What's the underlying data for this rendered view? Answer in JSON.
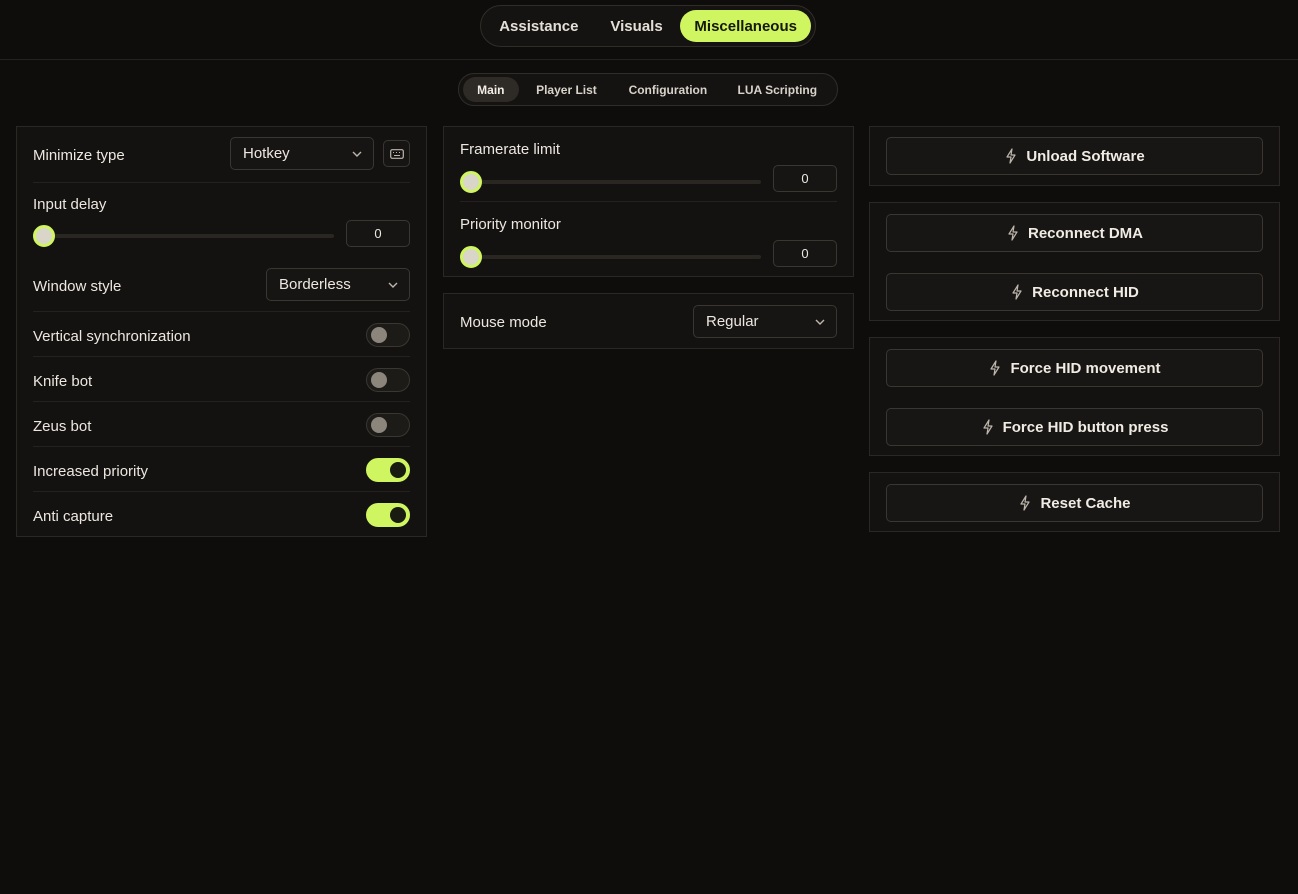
{
  "main_tabs": [
    {
      "label": "Assistance",
      "active": false
    },
    {
      "label": "Visuals",
      "active": false
    },
    {
      "label": "Miscellaneous",
      "active": true
    }
  ],
  "sub_tabs": [
    {
      "label": "Main",
      "active": true
    },
    {
      "label": "Player List",
      "active": false
    },
    {
      "label": "Configuration",
      "active": false
    },
    {
      "label": "LUA Scripting",
      "active": false
    }
  ],
  "left_panel": {
    "minimize_type": {
      "label": "Minimize type",
      "value": "Hotkey",
      "icon": "keyboard-icon"
    },
    "input_delay": {
      "label": "Input delay",
      "value": "0",
      "fraction": 0
    },
    "window_style": {
      "label": "Window style",
      "value": "Borderless"
    },
    "toggles": [
      {
        "label": "Vertical synchronization",
        "on": false
      },
      {
        "label": "Knife bot",
        "on": false
      },
      {
        "label": "Zeus bot",
        "on": false
      },
      {
        "label": "Increased priority",
        "on": true
      },
      {
        "label": "Anti capture",
        "on": true
      }
    ]
  },
  "middle_panel": {
    "framerate_limit": {
      "label": "Framerate limit",
      "value": "0",
      "fraction": 0
    },
    "priority_monitor": {
      "label": "Priority monitor",
      "value": "0",
      "fraction": 0
    },
    "mouse_mode": {
      "label": "Mouse mode",
      "value": "Regular"
    }
  },
  "right_panel": {
    "groups": [
      [
        "Unload Software"
      ],
      [
        "Reconnect DMA",
        "Reconnect HID"
      ],
      [
        "Force HID movement",
        "Force HID button press"
      ],
      [
        "Reset Cache"
      ]
    ],
    "button_icon": "bolt-icon"
  },
  "colors": {
    "accent": "#cff560",
    "background": "#0e0d0c",
    "panel": "#141210"
  }
}
